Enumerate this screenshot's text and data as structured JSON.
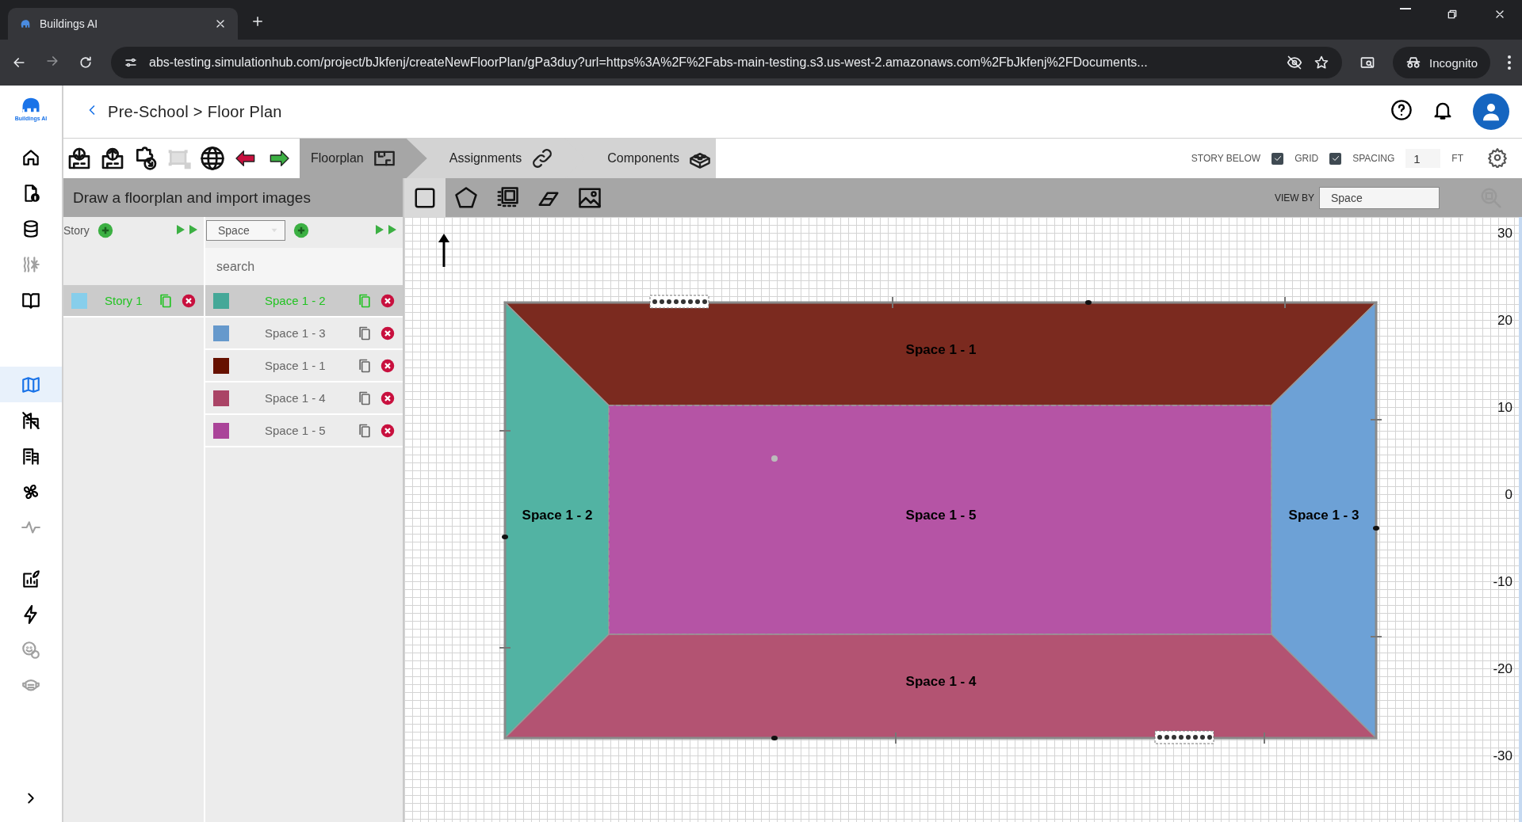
{
  "browser": {
    "tab_title": "Buildings AI",
    "url": "abs-testing.simulationhub.com/project/bJkfenj/createNewFloorPlan/gPa3duy?url=https%3A%2F%2Fabs-main-testing.s3.us-west-2.amazonaws.com%2FbJkfenj%2FDocuments...",
    "profile": "Incognito"
  },
  "sidebar": {
    "logo": "Buildings AI",
    "items": [
      {
        "selected": false,
        "disabled": false
      },
      {
        "selected": false,
        "disabled": false
      },
      {
        "selected": false,
        "disabled": false
      },
      {
        "selected": false,
        "disabled": true
      },
      {
        "selected": false,
        "disabled": false
      },
      {
        "selected": true,
        "disabled": false
      },
      {
        "selected": false,
        "disabled": false
      },
      {
        "selected": false,
        "disabled": false
      },
      {
        "selected": false,
        "disabled": false
      },
      {
        "selected": false,
        "disabled": true
      },
      {
        "selected": false,
        "disabled": false
      },
      {
        "selected": false,
        "disabled": false
      },
      {
        "selected": false,
        "disabled": true
      },
      {
        "selected": false,
        "disabled": true
      }
    ]
  },
  "header": {
    "breadcrumb": "Pre-School > Floor Plan"
  },
  "toolbar": {
    "actions": [
      {
        "disabled": false
      },
      {
        "disabled": false
      },
      {
        "disabled": false
      },
      {
        "disabled": true
      },
      {
        "disabled": false
      },
      {
        "disabled": false
      },
      {
        "disabled": false
      }
    ],
    "tabs": [
      {
        "label": "Floorplan",
        "selected": true
      },
      {
        "label": "Assignments",
        "selected": false
      },
      {
        "label": "Components",
        "selected": false
      }
    ],
    "options": [
      {
        "kind": "checkbox",
        "label": "STORY BELOW",
        "checked": true
      },
      {
        "kind": "checkbox",
        "label": "GRID",
        "checked": true
      },
      {
        "kind": "number",
        "label": "SPACING",
        "value": "1",
        "unit": "FT"
      }
    ]
  },
  "panel": {
    "title": "Draw a floorplan and import images",
    "story_label": "Story",
    "space_filter": "Space",
    "search": {
      "placeholder": "search"
    },
    "stories": [
      {
        "name": "Story 1",
        "color": "#87ceeb",
        "selected": true
      }
    ],
    "spaces": [
      {
        "name": "Space 1 - 2",
        "color": "#45a898",
        "selected": true
      },
      {
        "name": "Space 1 - 3",
        "color": "#6699cc",
        "selected": false
      },
      {
        "name": "Space 1 - 1",
        "color": "#661100",
        "selected": false
      },
      {
        "name": "Space 1 - 4",
        "color": "#aa4466",
        "selected": false
      },
      {
        "name": "Space 1 - 5",
        "color": "#aa4499",
        "selected": false
      }
    ]
  },
  "draw_tools": {
    "tools": [
      {
        "selected": true
      },
      {
        "selected": false
      },
      {
        "selected": false
      },
      {
        "selected": false
      },
      {
        "selected": false
      }
    ],
    "view_by": {
      "label": "VIEW BY",
      "value": "Space"
    }
  },
  "canvas": {
    "regions": [
      {
        "kind": "top",
        "label": "Space 1 - 1",
        "color": "#7b2a1f"
      },
      {
        "kind": "left",
        "label": "Space 1 - 2",
        "color": "#52b3a3"
      },
      {
        "kind": "center",
        "label": "Space 1 - 5",
        "color": "#b554a5"
      },
      {
        "kind": "right",
        "label": "Space 1 - 3",
        "color": "#6da1d6"
      },
      {
        "kind": "bottom",
        "label": "Space 1 - 4",
        "color": "#b35372"
      }
    ],
    "y_axis": [
      "30",
      "20",
      "10",
      "0",
      "-10",
      "-20",
      "-30"
    ]
  }
}
